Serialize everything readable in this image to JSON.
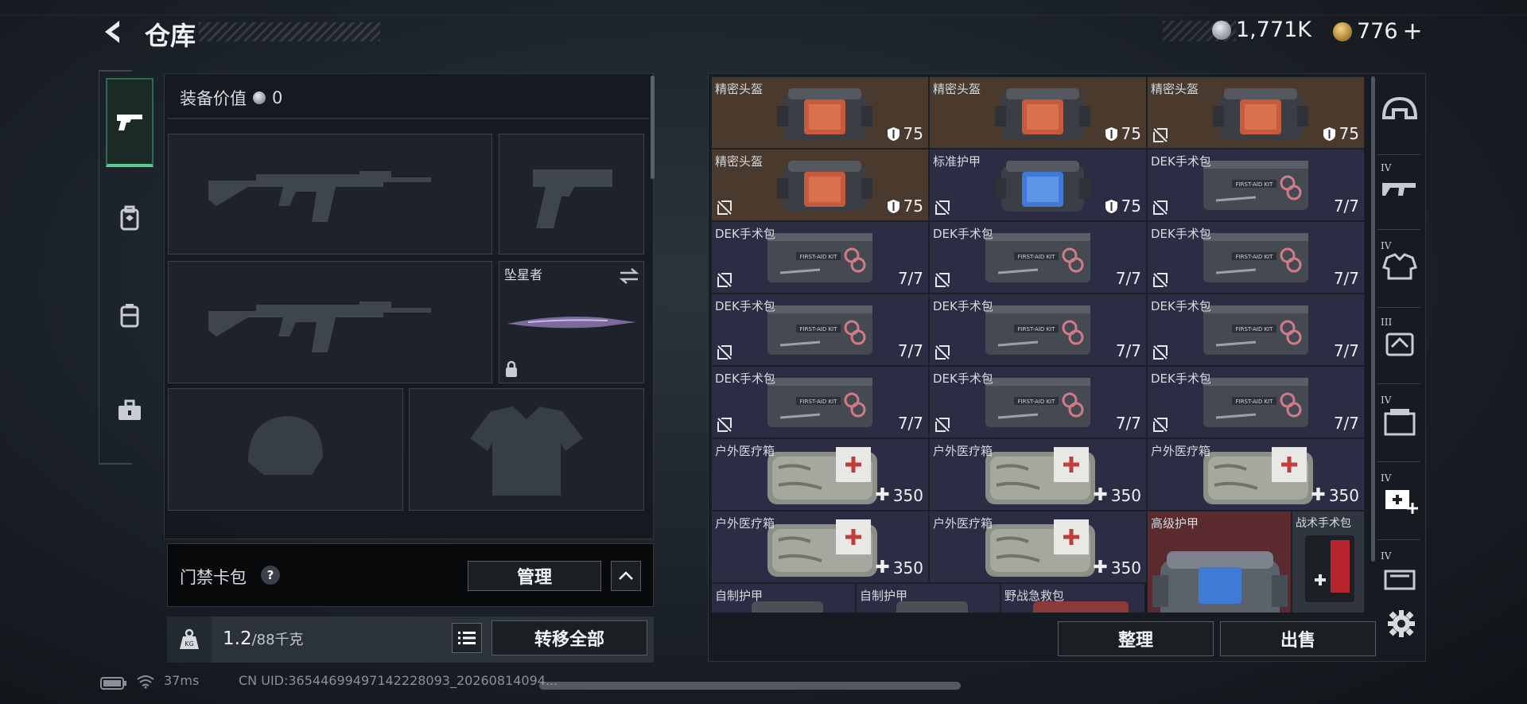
{
  "header": {
    "title": "仓库",
    "currency_silver": "1,771K",
    "currency_gold": "776",
    "gold_add_label": "+"
  },
  "nav": {
    "items": [
      {
        "name": "weapons",
        "icon": "pistol-icon",
        "active": true
      },
      {
        "name": "gear",
        "icon": "backpack-icon",
        "active": false
      },
      {
        "name": "bag",
        "icon": "case-icon",
        "active": false
      },
      {
        "name": "medical",
        "icon": "toolbox-icon",
        "active": false
      }
    ]
  },
  "loadout": {
    "value_label": "装备价值",
    "value": "0",
    "melee_name": "坠星者",
    "keycard_label": "门禁卡包",
    "keycard_help": "?",
    "manage_label": "管理",
    "weight_current": "1.2",
    "weight_max": "/88千克",
    "transfer_all_label": "转移全部"
  },
  "storage": {
    "items": [
      {
        "name": "精密头盔",
        "value": "75",
        "kind": "helmet",
        "bg": "#4a3a2e",
        "no_insure": false
      },
      {
        "name": "精密头盔",
        "value": "75",
        "kind": "helmet",
        "bg": "#4a3a2e",
        "no_insure": false
      },
      {
        "name": "精密头盔",
        "value": "75",
        "kind": "helmet",
        "bg": "#4a3a2e",
        "no_insure": true
      },
      {
        "name": "精密头盔",
        "value": "75",
        "kind": "helmet",
        "bg": "#4a3a2e",
        "no_insure": true
      },
      {
        "name": "标准护甲",
        "value": "75",
        "kind": "armor",
        "bg": "#2c2d44",
        "no_insure": true
      },
      {
        "name": "DEK手术包",
        "value": "7/7",
        "kind": "kit",
        "bg": "#2c2d44",
        "no_insure": true
      },
      {
        "name": "DEK手术包",
        "value": "7/7",
        "kind": "kit",
        "bg": "#2c2d44",
        "no_insure": true
      },
      {
        "name": "DEK手术包",
        "value": "7/7",
        "kind": "kit",
        "bg": "#2c2d44",
        "no_insure": true
      },
      {
        "name": "DEK手术包",
        "value": "7/7",
        "kind": "kit",
        "bg": "#2c2d44",
        "no_insure": true
      },
      {
        "name": "DEK手术包",
        "value": "7/7",
        "kind": "kit",
        "bg": "#2c2d44",
        "no_insure": true
      },
      {
        "name": "DEK手术包",
        "value": "7/7",
        "kind": "kit",
        "bg": "#2c2d44",
        "no_insure": true
      },
      {
        "name": "DEK手术包",
        "value": "7/7",
        "kind": "kit",
        "bg": "#2c2d44",
        "no_insure": true
      },
      {
        "name": "DEK手术包",
        "value": "7/7",
        "kind": "kit",
        "bg": "#2c2d44",
        "no_insure": true
      },
      {
        "name": "DEK手术包",
        "value": "7/7",
        "kind": "kit",
        "bg": "#2c2d44",
        "no_insure": true
      },
      {
        "name": "DEK手术包",
        "value": "7/7",
        "kind": "kit",
        "bg": "#2c2d44",
        "no_insure": true
      },
      {
        "name": "户外医疗箱",
        "value": "350",
        "kind": "medbox",
        "bg": "#2c2d44",
        "no_insure": false
      },
      {
        "name": "户外医疗箱",
        "value": "350",
        "kind": "medbox",
        "bg": "#2c2d44",
        "no_insure": false
      },
      {
        "name": "户外医疗箱",
        "value": "350",
        "kind": "medbox",
        "bg": "#2c2d44",
        "no_insure": false
      },
      {
        "name": "户外医疗箱",
        "value": "350",
        "kind": "medbox",
        "bg": "#2c2d44",
        "no_insure": false
      },
      {
        "name": "户外医疗箱",
        "value": "350",
        "kind": "medbox",
        "bg": "#2c2d44",
        "no_insure": false
      }
    ],
    "big_armor_name": "高级护甲",
    "tactical_kit_name": "战术手术包",
    "bottom_row": [
      "自制护甲",
      "自制护甲",
      "野战急救包"
    ],
    "sort_label": "整理",
    "sell_label": "出售"
  },
  "rail": {
    "items": [
      {
        "icon": "helmet-icon",
        "tier": ""
      },
      {
        "icon": "rifle-icon",
        "tier": "IV"
      },
      {
        "icon": "armor-icon",
        "tier": "IV"
      },
      {
        "icon": "bag-icon",
        "tier": "III"
      },
      {
        "icon": "container-icon",
        "tier": "IV"
      },
      {
        "icon": "medkit-add-icon",
        "tier": "IV"
      },
      {
        "icon": "misc-icon",
        "tier": "IV"
      }
    ]
  },
  "status": {
    "ping": "37ms",
    "uid": "CN UID:36544699497142228093_20260814094..."
  },
  "colors": {
    "accent_green": "#4fcf92",
    "helmet_bg": "#4a3a2e",
    "item_bg": "#2c2d44",
    "high_armor_bg": "#5a2a2e"
  }
}
